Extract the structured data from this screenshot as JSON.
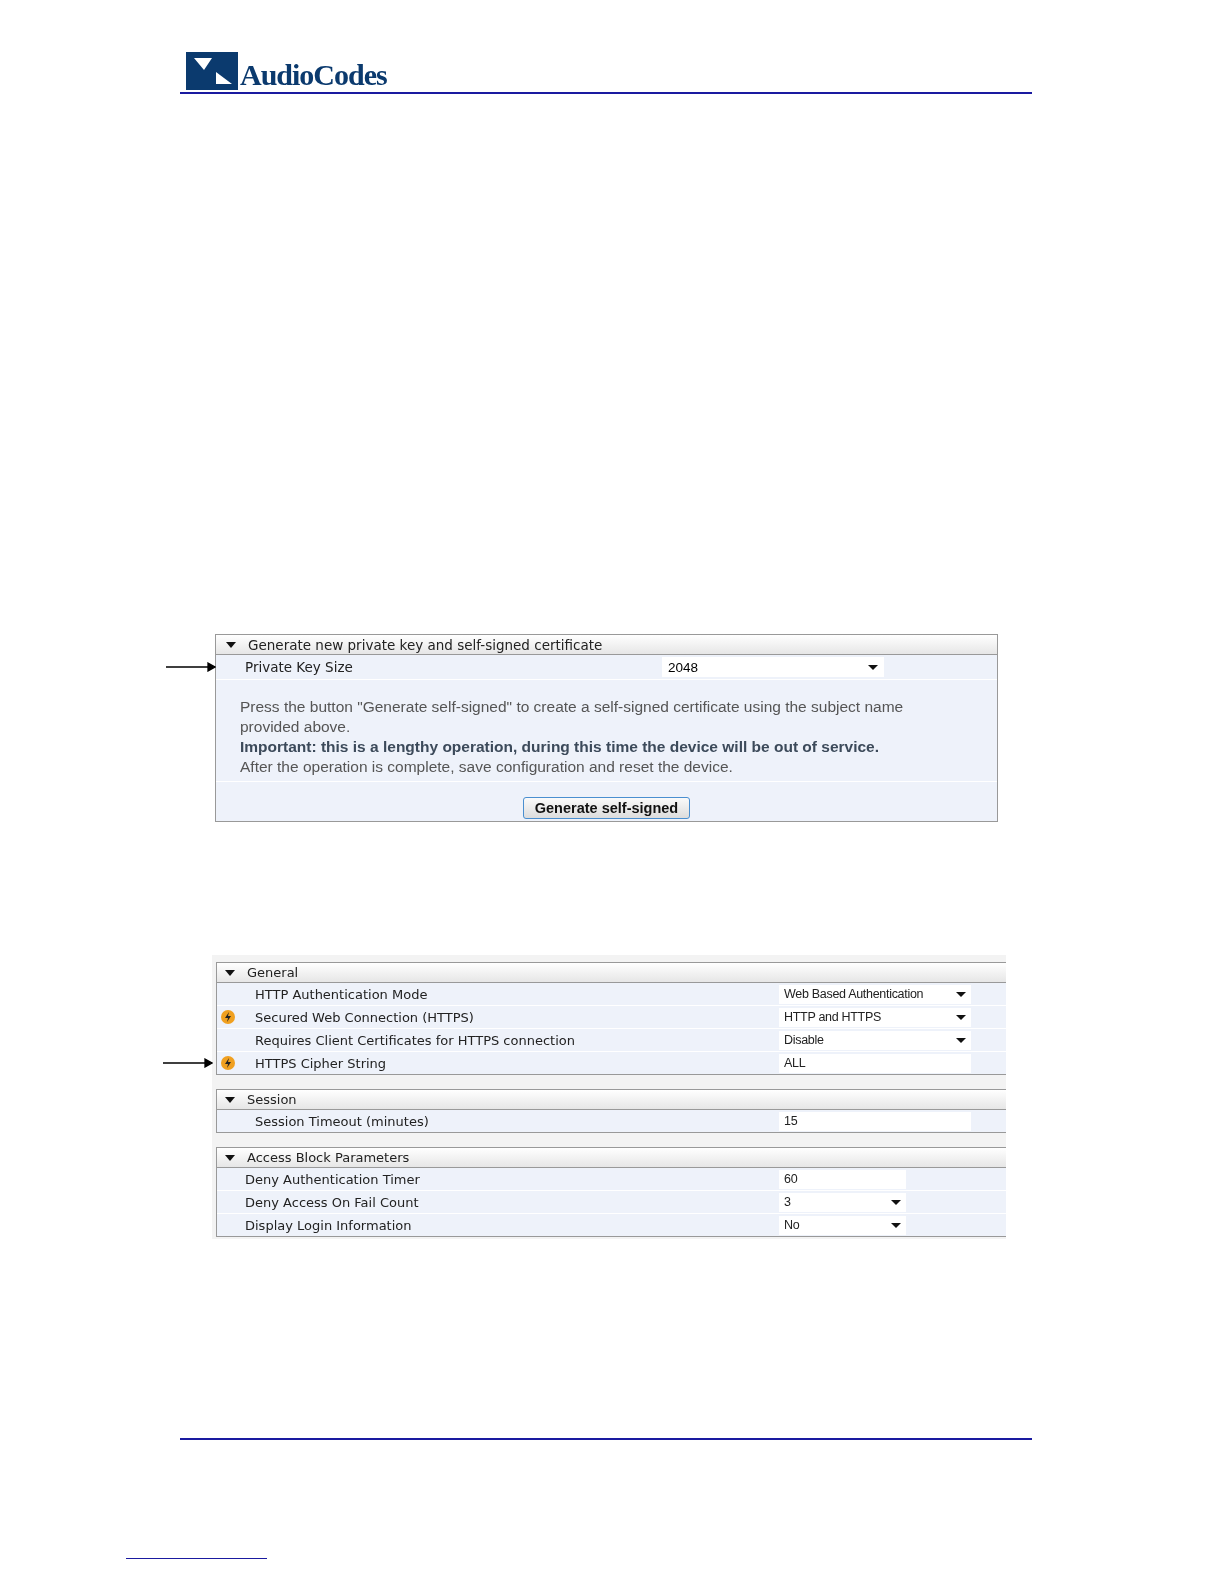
{
  "header": {
    "logo": "AudioCodes"
  },
  "panel_1": {
    "section": {
      "title": "Generate new private key and self-signed certificate",
      "expanded": true
    },
    "fields": [
      {
        "label": "Private Key Size",
        "kind": "select",
        "value": "2048",
        "pointer": true
      }
    ],
    "message": [
      {
        "text": "Press the button \"Generate self-signed\" to create a self-signed certificate using the subject name provided above.",
        "bold": false
      },
      {
        "text": "Important: this is a lengthy operation, during this time the device will be out of service.",
        "bold": true
      },
      {
        "text": "After the operation is complete, save configuration and reset the device.",
        "bold": false
      }
    ],
    "button": "Generate self-signed"
  },
  "panel_2": {
    "sections": [
      {
        "title": "General",
        "expanded": true,
        "rows": [
          {
            "label": "HTTP Authentication Mode",
            "kind": "select",
            "value": "Web Based Authentication",
            "flagged": false,
            "pointer": false
          },
          {
            "label": "Secured Web Connection (HTTPS)",
            "kind": "select",
            "value": "HTTP and HTTPS",
            "flagged": true,
            "pointer": false
          },
          {
            "label": "Requires Client Certificates for HTTPS connection",
            "kind": "select",
            "value": "Disable",
            "flagged": false,
            "pointer": false
          },
          {
            "label": "HTTPS Cipher String",
            "kind": "text",
            "value": "ALL",
            "flagged": true,
            "pointer": true
          }
        ]
      },
      {
        "title": "Session",
        "expanded": true,
        "rows": [
          {
            "label": "Session Timeout (minutes)",
            "kind": "text",
            "value": "15",
            "flagged": false,
            "pointer": false
          }
        ]
      },
      {
        "title": "Access Block Parameters",
        "expanded": true,
        "rows": [
          {
            "label": "Deny Authentication Timer",
            "kind": "text",
            "value": "60",
            "flagged": false,
            "pointer": false
          },
          {
            "label": "Deny Access On Fail Count",
            "kind": "select",
            "value": "3",
            "flagged": false,
            "pointer": false
          },
          {
            "label": "Display Login Information",
            "kind": "select",
            "value": "No",
            "flagged": false,
            "pointer": false
          }
        ]
      }
    ]
  }
}
